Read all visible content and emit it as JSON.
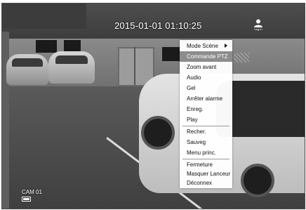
{
  "overlay": {
    "datetime": "2015-01-01 01:10:25",
    "login_label": "Log In",
    "camera_name": "CAM 01",
    "camera_icon": "ptz-camera-icon"
  },
  "menu": {
    "items": [
      {
        "label": "Mode Scène",
        "has_submenu": true
      },
      {
        "label": "Commande PTZ",
        "highlighted": true
      },
      {
        "label": "Zoom avant"
      },
      {
        "label": "Audio"
      },
      {
        "label": "Gel"
      },
      {
        "label": "Arrêter alarme"
      },
      {
        "label": "Enreg."
      },
      {
        "label": "Play"
      },
      {
        "label": "Recher."
      },
      {
        "label": "Sauveg"
      },
      {
        "label": "Menu princ."
      },
      {
        "label": "Fermeture"
      },
      {
        "label": "Masquer Lanceur"
      },
      {
        "label": "Déconnex"
      }
    ]
  },
  "colors": {
    "menu_background": "#ffffff",
    "menu_highlight": "#8d8d8d",
    "overlay_text": "#ffffff"
  }
}
